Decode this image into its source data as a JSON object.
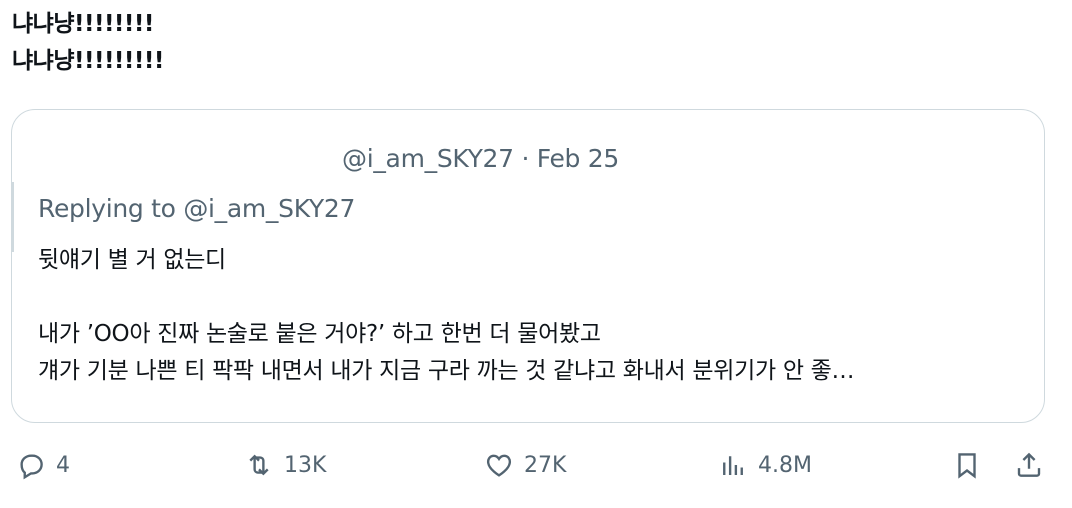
{
  "tweet": {
    "lines": [
      "냐냐냥!!!!!!!!",
      "냐냐냥!!!!!!!!!"
    ]
  },
  "quote": {
    "handle": "@i_am_SKY27",
    "separator": "·",
    "date": "Feb 25",
    "replying_prefix": "Replying to",
    "replying_handle": "@i_am_SKY27",
    "body_lines": [
      "뒷얘기 별 거 없는디",
      "",
      "내가 ’OO아 진짜 논술로 붙은 거야?’ 하고 한번 더 물어봤고",
      "걔가 기분 나쁜 티 팍팍 내면서 내가 지금 구라 까는 것 같냐고 화내서 분위기가 안 좋…"
    ]
  },
  "actions": {
    "reply_count": "4",
    "retweet_count": "13K",
    "like_count": "27K",
    "view_count": "4.8M",
    "icons": [
      "reply-icon",
      "retweet-icon",
      "like-icon",
      "views-icon",
      "bookmark-icon",
      "share-icon"
    ]
  },
  "colors": {
    "text": "#0f1419",
    "secondary": "#536471",
    "border": "#cfd9de"
  }
}
